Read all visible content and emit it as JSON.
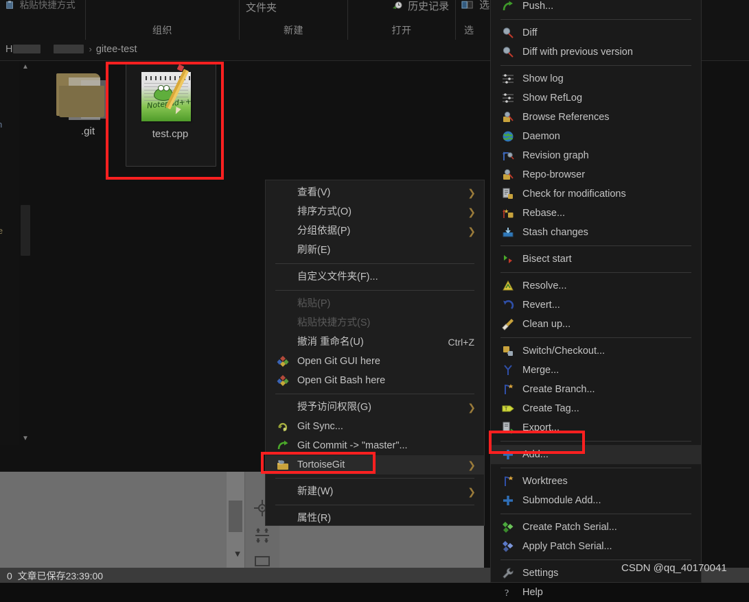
{
  "window": {
    "app": "Windows File Explorer (dark theme)",
    "breadcrumb": {
      "prefix": "H",
      "current_folder": "gitee-test",
      "separator": "›"
    }
  },
  "ribbon": {
    "commands": [
      {
        "label": "粘贴快捷方式",
        "icon": "paste-shortcut-icon"
      },
      {
        "label": "文件夹",
        "icon": "new-folder-icon"
      },
      {
        "label": "历史记录",
        "icon": "history-icon"
      },
      {
        "label": "选",
        "icon": "select-icon"
      }
    ],
    "groups": [
      {
        "label": "组织"
      },
      {
        "label": "新建"
      },
      {
        "label": "打开"
      },
      {
        "label": "选"
      }
    ]
  },
  "files": [
    {
      "name": ".git",
      "icon": "folder-icon",
      "selected": false
    },
    {
      "name": "test.cpp",
      "icon": "notepadpp-document-icon",
      "selected": true
    }
  ],
  "explorer_menu": {
    "items": [
      {
        "label": "查看(V)",
        "submenu": true,
        "icon": null,
        "disabled": false
      },
      {
        "label": "排序方式(O)",
        "submenu": true,
        "icon": null,
        "disabled": false
      },
      {
        "label": "分组依据(P)",
        "submenu": true,
        "icon": null,
        "disabled": false
      },
      {
        "label": "刷新(E)",
        "submenu": false,
        "icon": null,
        "disabled": false
      },
      {
        "separator": true
      },
      {
        "label": "自定义文件夹(F)...",
        "submenu": false,
        "icon": null,
        "disabled": false
      },
      {
        "separator": true
      },
      {
        "label": "粘贴(P)",
        "submenu": false,
        "icon": null,
        "disabled": true
      },
      {
        "label": "粘贴快捷方式(S)",
        "submenu": false,
        "icon": null,
        "disabled": true
      },
      {
        "label": "撤消 重命名(U)",
        "submenu": false,
        "icon": null,
        "disabled": false,
        "accel": "Ctrl+Z"
      },
      {
        "label": "Open Git GUI here",
        "submenu": false,
        "icon": "git-diamond-icon",
        "disabled": false
      },
      {
        "label": "Open Git Bash here",
        "submenu": false,
        "icon": "git-diamond-icon",
        "disabled": false
      },
      {
        "separator": true
      },
      {
        "label": "授予访问权限(G)",
        "submenu": true,
        "icon": null,
        "disabled": false
      },
      {
        "label": "Git Sync...",
        "submenu": false,
        "icon": "git-sync-icon",
        "disabled": false
      },
      {
        "label": "Git Commit -> \"master\"...",
        "submenu": false,
        "icon": "git-commit-icon",
        "disabled": false
      },
      {
        "label": "TortoiseGit",
        "submenu": true,
        "icon": "tortoisegit-icon",
        "disabled": false,
        "highlighted": true,
        "annotated": true
      },
      {
        "separator": true
      },
      {
        "label": "新建(W)",
        "submenu": true,
        "icon": null,
        "disabled": false
      },
      {
        "separator": true
      },
      {
        "label": "属性(R)",
        "submenu": false,
        "icon": null,
        "disabled": false
      }
    ]
  },
  "tortoisegit_menu": {
    "items": [
      {
        "label": "Push...",
        "icon": "push-arrow-icon"
      },
      {
        "separator": true
      },
      {
        "label": "Diff",
        "icon": "magnifier-icon"
      },
      {
        "label": "Diff with previous version",
        "icon": "magnifier-icon"
      },
      {
        "separator": true
      },
      {
        "label": "Show log",
        "icon": "log-lines-icon"
      },
      {
        "label": "Show RefLog",
        "icon": "log-lines-icon"
      },
      {
        "label": "Browse References",
        "icon": "browse-refs-icon"
      },
      {
        "label": "Daemon",
        "icon": "globe-icon"
      },
      {
        "label": "Revision graph",
        "icon": "revision-graph-icon"
      },
      {
        "label": "Repo-browser",
        "icon": "browse-refs-icon"
      },
      {
        "label": "Check for modifications",
        "icon": "check-modifications-icon"
      },
      {
        "label": "Rebase...",
        "icon": "rebase-icon"
      },
      {
        "label": "Stash changes",
        "icon": "stash-icon"
      },
      {
        "separator": true
      },
      {
        "label": "Bisect start",
        "icon": "bisect-icon"
      },
      {
        "separator": true
      },
      {
        "label": "Resolve...",
        "icon": "resolve-icon"
      },
      {
        "label": "Revert...",
        "icon": "revert-icon"
      },
      {
        "label": "Clean up...",
        "icon": "broom-icon"
      },
      {
        "separator": true
      },
      {
        "label": "Switch/Checkout...",
        "icon": "switch-checkout-icon"
      },
      {
        "label": "Merge...",
        "icon": "merge-icon"
      },
      {
        "label": "Create Branch...",
        "icon": "branch-icon"
      },
      {
        "label": "Create Tag...",
        "icon": "tag-icon"
      },
      {
        "label": "Export...",
        "icon": "export-icon"
      },
      {
        "separator": true
      },
      {
        "label": "Add...",
        "icon": "plus-icon",
        "highlighted": true,
        "annotated": true
      },
      {
        "separator": true
      },
      {
        "label": "Worktrees",
        "icon": "branch-icon"
      },
      {
        "label": "Submodule Add...",
        "icon": "plus-icon"
      },
      {
        "separator": true
      },
      {
        "label": "Create Patch Serial...",
        "icon": "patch-green-icon"
      },
      {
        "label": "Apply Patch Serial...",
        "icon": "patch-blue-icon"
      },
      {
        "separator": true
      },
      {
        "label": "Settings",
        "icon": "wrench-icon"
      },
      {
        "label": "Help",
        "icon": "help-icon"
      }
    ]
  },
  "status_bar": {
    "count": "0",
    "message": "文章已保存23:39:00"
  },
  "watermark": {
    "text": "CSDN @qq_40170041"
  },
  "annotations": {
    "color": "#ff2020",
    "boxes": [
      {
        "name": "selected-file-highlight",
        "target": "test.cpp"
      },
      {
        "name": "tortoisegit-item-highlight",
        "target": "TortoiseGit"
      },
      {
        "name": "add-item-highlight",
        "target": "Add..."
      }
    ]
  },
  "colors": {
    "menu_background": "#1e1e1e",
    "menu_text": "#c4c4c4",
    "menu_disabled": "#5a5a5a",
    "highlight_row": "#2a2a2a",
    "annotation_red": "#ff2020",
    "status_bar": "#3b3b3b",
    "grey_panel": "#6e6e6e"
  }
}
